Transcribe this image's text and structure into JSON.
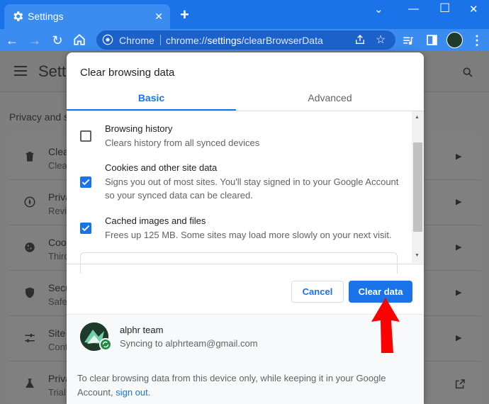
{
  "browser": {
    "tab": {
      "title": "Settings",
      "icon": "gear-icon"
    },
    "toolbar": {
      "omnibox_label": "Chrome",
      "url_prefix": "chrome://",
      "url_host": "settings",
      "url_path": "/clearBrowserData"
    },
    "accent_color": "#1a73e8"
  },
  "settings": {
    "title": "Setti",
    "section_title": "Privacy and s",
    "rows": [
      {
        "title": "Clea",
        "desc": "Clea",
        "icon": "trash-icon"
      },
      {
        "title": "Priva",
        "desc": "Revie",
        "icon": "compass-icon"
      },
      {
        "title": "Cook",
        "desc": "Third",
        "icon": "cookie-icon"
      },
      {
        "title": "Secu",
        "desc": "Safe",
        "icon": "shield-icon"
      },
      {
        "title": "Site",
        "desc": "Conti",
        "icon": "sliders-icon"
      },
      {
        "title": "Priva",
        "desc": "Trial",
        "icon": "flask-icon"
      }
    ]
  },
  "dialog": {
    "title": "Clear browsing data",
    "tabs": {
      "basic": "Basic",
      "advanced": "Advanced"
    },
    "options": [
      {
        "title": "Browsing history",
        "desc": "Clears history from all synced devices",
        "checked": false
      },
      {
        "title": "Cookies and other site data",
        "desc": "Signs you out of most sites. You'll stay signed in to your Google Account so your synced data can be cleared.",
        "checked": true
      },
      {
        "title": "Cached images and files",
        "desc": "Frees up 125 MB. Some sites may load more slowly on your next visit.",
        "checked": true
      }
    ],
    "cancel_label": "Cancel",
    "clear_label": "Clear data",
    "account": {
      "name": "alphr team",
      "sync_status": "Syncing to alphrteam@gmail.com"
    },
    "footer": {
      "text": "To clear browsing data from this device only, while keeping it in your Google Account,",
      "link": "sign out."
    }
  }
}
